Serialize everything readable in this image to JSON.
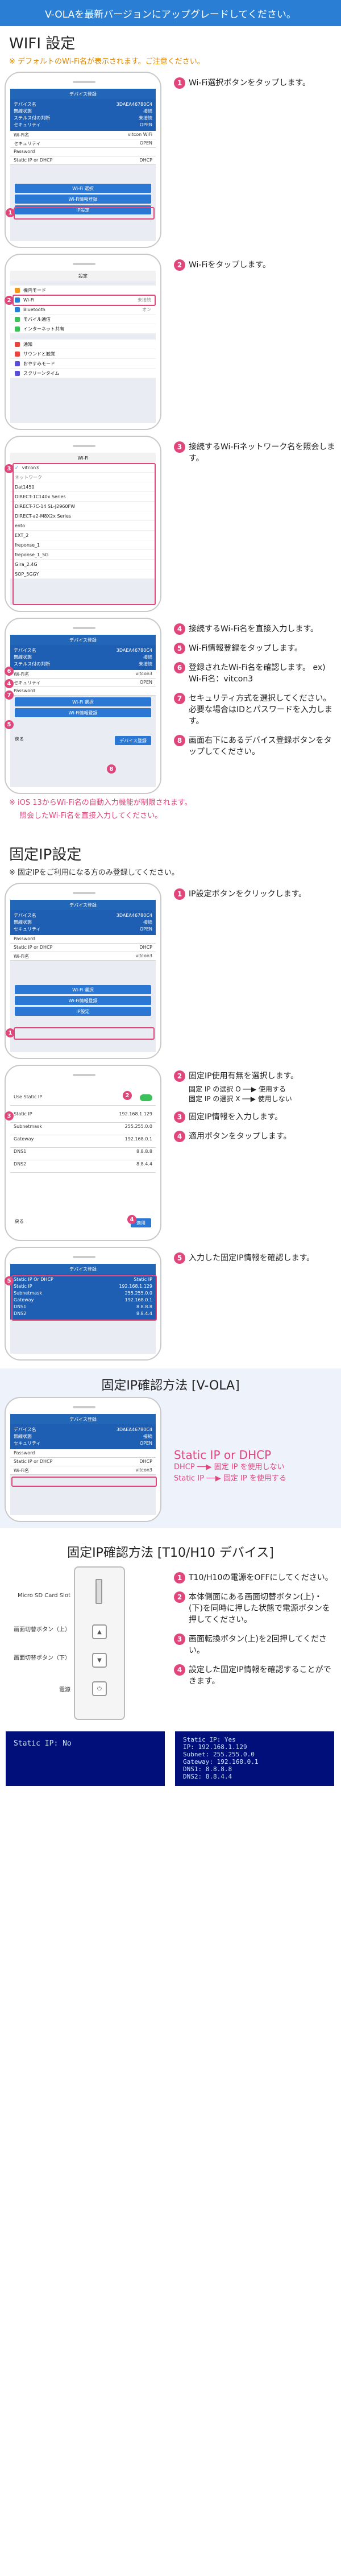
{
  "banner": "V-OLAを最新バージョンにアップグレードしてください。",
  "wifi": {
    "title": "WIFI 設定",
    "note": "※ デフォルトのWi-Fi名が表示されます。ご注意ください。",
    "screen1": {
      "appbar": "デバイス登録",
      "rows": [
        [
          "デバイス名",
          "3DAEA46780C4"
        ],
        [
          "無線状態",
          "接続"
        ],
        [
          "ステルス付の判断",
          "未接続"
        ],
        [
          "セキュリティ",
          "OPEN"
        ]
      ],
      "fields": [
        [
          "Wi-Fi名",
          "vitcon WiFi"
        ],
        [
          "セキュリティ",
          "OPEN"
        ],
        [
          "Password",
          ""
        ],
        [
          "Static IP or DHCP",
          "DHCP"
        ]
      ],
      "buttons": [
        "Wi-Fi 選択",
        "Wi-Fi情報登録",
        "IP設定"
      ]
    },
    "screen2": {
      "title": "設定",
      "items": [
        "機内モード",
        "Wi-Fi",
        "Bluetooth",
        "モバイル通信",
        "インターネット共有",
        "通知",
        "サウンドと触覚",
        "おやすみモード",
        "スクリーンタイム"
      ],
      "wifi_value": "未接続",
      "bt_value": "オン"
    },
    "screen3": {
      "title": "Wi-Fi",
      "current": "vitcon3",
      "section": "ネットワーク",
      "networks": [
        "Dat1450",
        "DIRECT-1C140x Series",
        "DIRECT-7C-14 SL-J2960FW",
        "DIRECT-a2-M8X2x Series",
        "ento",
        "EXT_2",
        "freponse_1",
        "freponse_1_5G",
        "Gira_2.4G",
        "SOP_5GGY",
        "SOP_5GGX"
      ]
    },
    "screen4": {
      "appbar": "デバイス登録",
      "wifi_name": "vitcon3",
      "register": "デバイス登録",
      "back": "戻る"
    },
    "steps": [
      "Wi-Fi選択ボタンをタップします。",
      "Wi-Fiをタップします。",
      "接続するWi-Fiネットワーク名を照会します。",
      "接続するWi-Fi名を直接入力します。",
      "Wi-Fi情報登録をタップします。",
      "登録されたWi-Fi名を確認します。 ex) Wi-Fi名：vitcon3",
      "セキュリティ方式を選択してください。必要な場合はIDとパスワードを入力します。",
      "画面右下にあるデバイス登録ボタンをタップしてください。"
    ],
    "ios_note1": "※ iOS 13からWi-Fi名の自動入力機能が制限されます。",
    "ios_note2": "照会したWi-Fi名を直接入力してください。"
  },
  "static": {
    "title": "固定IP設定",
    "note": "※ 固定IPをご利用になる方のみ登録してください。",
    "steps": [
      "IP設定ボタンをクリックします。",
      "固定IP使用有無を選択します。",
      "固定IP情報を入力します。",
      "適用ボタンをタップします。",
      "入力した固定IP情報を確認します。"
    ],
    "opt_on": "固定 IP の選択 O ──▶ 使用する",
    "opt_off": "固定 IP の選択 X ──▶ 使用しない",
    "form": {
      "toggle_label": "Use Static IP",
      "fields": [
        [
          "Static IP",
          "192.168.1.129"
        ],
        [
          "Subnetmask",
          "255.255.0.0"
        ],
        [
          "Gateway",
          "192.168.0.1"
        ],
        [
          "DNS1",
          "8.8.8.8"
        ],
        [
          "DNS2",
          "8.8.4.4"
        ]
      ],
      "back": "戻る",
      "apply": "適用"
    },
    "confirm_rows": [
      [
        "Static IP Or DHCP",
        "Static IP"
      ],
      [
        "Static IP",
        "192.168.1.129"
      ],
      [
        "Subnetmask",
        "255.255.0.0"
      ],
      [
        "Gateway",
        "192.168.0.1"
      ],
      [
        "DNS1",
        "8.8.8.8"
      ],
      [
        "DNS2",
        "8.8.4.4"
      ]
    ]
  },
  "vola_check": {
    "title": "固定IP確認方法 [V-OLA]",
    "label": "Static IP or DHCP",
    "line1": "DHCP ──▶ 固定 IP を使用しない",
    "line2": "Static IP ──▶ 固定 IP を使用する"
  },
  "device_check": {
    "title": "固定IP確認方法 [T10/H10 デバイス]",
    "labels": [
      "Micro SD Card Slot",
      "画面切替ボタン（上）",
      "画面切替ボタン（下）",
      "電源"
    ],
    "steps": [
      "T10/H10の電源をOFFにしてください。",
      "本体側面にある画面切替ボタン(上)・(下)を同時に押した状態で電源ボタンを押してください。",
      "画面転換ボタン(上)を2回押してください。",
      "設定した固定IP情報を確認することができます。"
    ],
    "term_no": "Static IP: No",
    "term_yes": [
      "Static IP: Yes",
      "IP: 192.168.1.129",
      "Subnet: 255.255.0.0",
      "Gateway: 192.168.0.1",
      "DNS1: 8.8.8.8",
      "DNS2: 8.8.4.4"
    ]
  },
  "colors": {
    "accent": "#e0457b",
    "brand": "#2a7fd4",
    "note": "#e08a00"
  }
}
